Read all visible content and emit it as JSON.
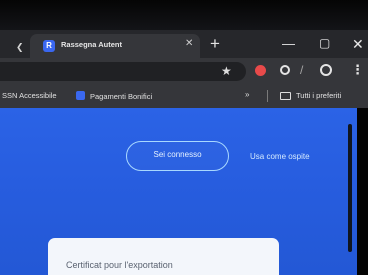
{
  "browser": {
    "tab_title": "Rassegna Autent",
    "new_tab": "+",
    "bookmarks": [
      {
        "label": "SSN Accessibile"
      },
      {
        "label": "Pagamenti Bonifici"
      }
    ],
    "all_bookmarks": "Tutti i preferiti"
  },
  "page": {
    "signin_button": "Sei connesso",
    "guest_link": "Usa come ospite",
    "card_text": "Certificat pour l'exportation"
  },
  "icons": [
    "tab-favicon-icon",
    "close-icon",
    "plus-icon",
    "minimize-icon",
    "maximize-icon",
    "window-close-icon",
    "star-icon",
    "extension-icon",
    "profile-icon",
    "menu-icon",
    "folder-icon"
  ],
  "colors": {
    "page_blue": "#2b63e6",
    "chrome_dark": "#35363a",
    "button_outline": "#a8d8ff",
    "card": "#f3f6fb"
  }
}
